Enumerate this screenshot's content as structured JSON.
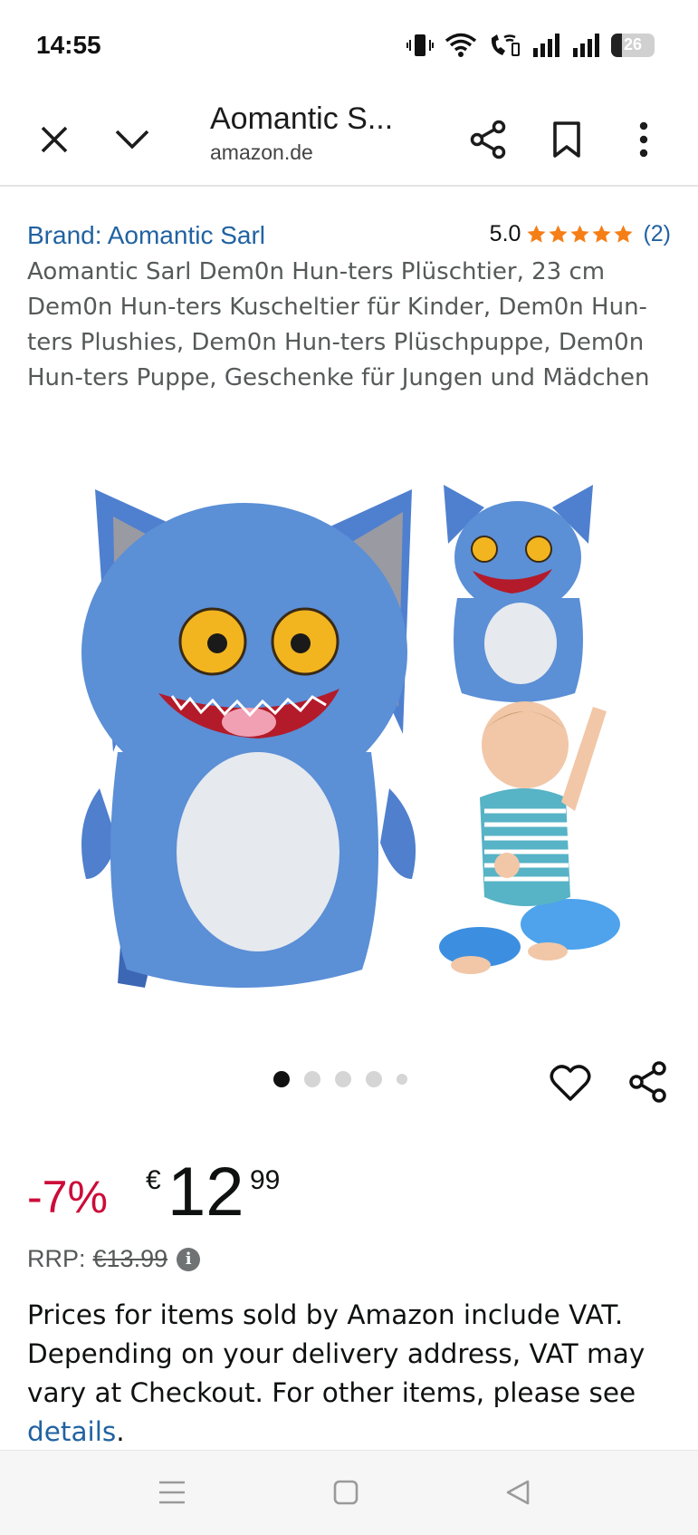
{
  "status_bar": {
    "time": "14:55",
    "battery_level": "26"
  },
  "toolbar": {
    "title": "Aomantic S...",
    "domain": "amazon.de",
    "icons": [
      "close-icon",
      "chevron-down-icon",
      "share-icon",
      "bookmark-icon",
      "more-vert-icon"
    ]
  },
  "product": {
    "brand_link": "Brand: Aomantic Sarl",
    "rating_value": "5.0",
    "rating_stars": 5,
    "rating_count": "(2)",
    "title": "Aomantic Sarl Dem0n Hun-ters Plüschtier, 23 cm Dem0n Hun-ters Kuscheltier für Kinder, Dem0n Hun-ters Plushies, Dem0n Hun-ters Plüschpuppe, Dem0n Hun-ters Puppe, Geschenke für Jungen und Mädchen"
  },
  "gallery": {
    "image_count": 5,
    "active_index": 0
  },
  "price": {
    "discount": "-7%",
    "currency": "€",
    "whole": "12",
    "fraction": "99",
    "rrp_label": "RRP:",
    "rrp_value": "€13.99",
    "info": "i",
    "vat_text": "Prices for items sold by Amazon include VAT. Depending on your delivery address, VAT may vary at Checkout. For other items, please see ",
    "vat_link": "details",
    "vat_end": "."
  },
  "colors": {
    "link": "#2162a1",
    "star": "#f57e16",
    "discount": "#cc0c39",
    "plush_blue": "#5b8fd6"
  }
}
